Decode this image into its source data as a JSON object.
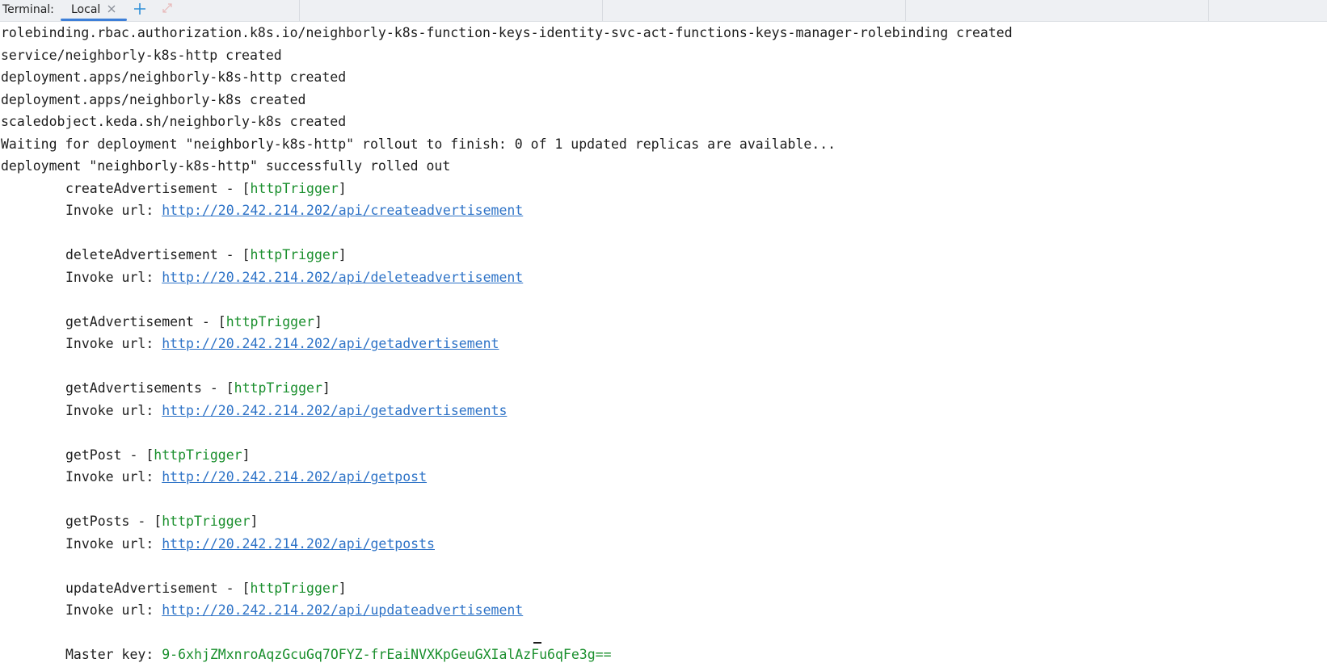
{
  "tabbar": {
    "title": "Terminal:",
    "tab_label": "Local",
    "close_glyph": "×",
    "add_glyph": "+",
    "icons": [
      "close-icon",
      "plus-icon",
      "expand-icon"
    ],
    "accent": "#3d7fd8"
  },
  "terminal": {
    "output_lines": [
      "rolebinding.rbac.authorization.k8s.io/neighborly-k8s-function-keys-identity-svc-act-functions-keys-manager-rolebinding created",
      "service/neighborly-k8s-http created",
      "deployment.apps/neighborly-k8s-http created",
      "deployment.apps/neighborly-k8s created",
      "scaledobject.keda.sh/neighborly-k8s created",
      "Waiting for deployment \"neighborly-k8s-http\" rollout to finish: 0 of 1 updated replicas are available...",
      "deployment \"neighborly-k8s-http\" successfully rolled out"
    ],
    "trigger_label": "httpTrigger",
    "invoke_label": "Invoke url: ",
    "functions": [
      {
        "name": "createAdvertisement",
        "url": "http://20.242.214.202/api/createadvertisement"
      },
      {
        "name": "deleteAdvertisement",
        "url": "http://20.242.214.202/api/deleteadvertisement"
      },
      {
        "name": "getAdvertisement",
        "url": "http://20.242.214.202/api/getadvertisement"
      },
      {
        "name": "getAdvertisements",
        "url": "http://20.242.214.202/api/getadvertisements"
      },
      {
        "name": "getPost",
        "url": "http://20.242.214.202/api/getpost"
      },
      {
        "name": "getPosts",
        "url": "http://20.242.214.202/api/getposts"
      },
      {
        "name": "updateAdvertisement",
        "url": "http://20.242.214.202/api/updateadvertisement"
      }
    ],
    "master_key_label": "Master key: ",
    "master_key": "9-6xhjZMxnroAqzGcuGq7OFYZ-frEaiNVXKpGeuGXIalAzFu6qFe3g==",
    "colors": {
      "text": "#1d1d1d",
      "trigger": "#1a8f2d",
      "link": "#2e73c7"
    }
  }
}
